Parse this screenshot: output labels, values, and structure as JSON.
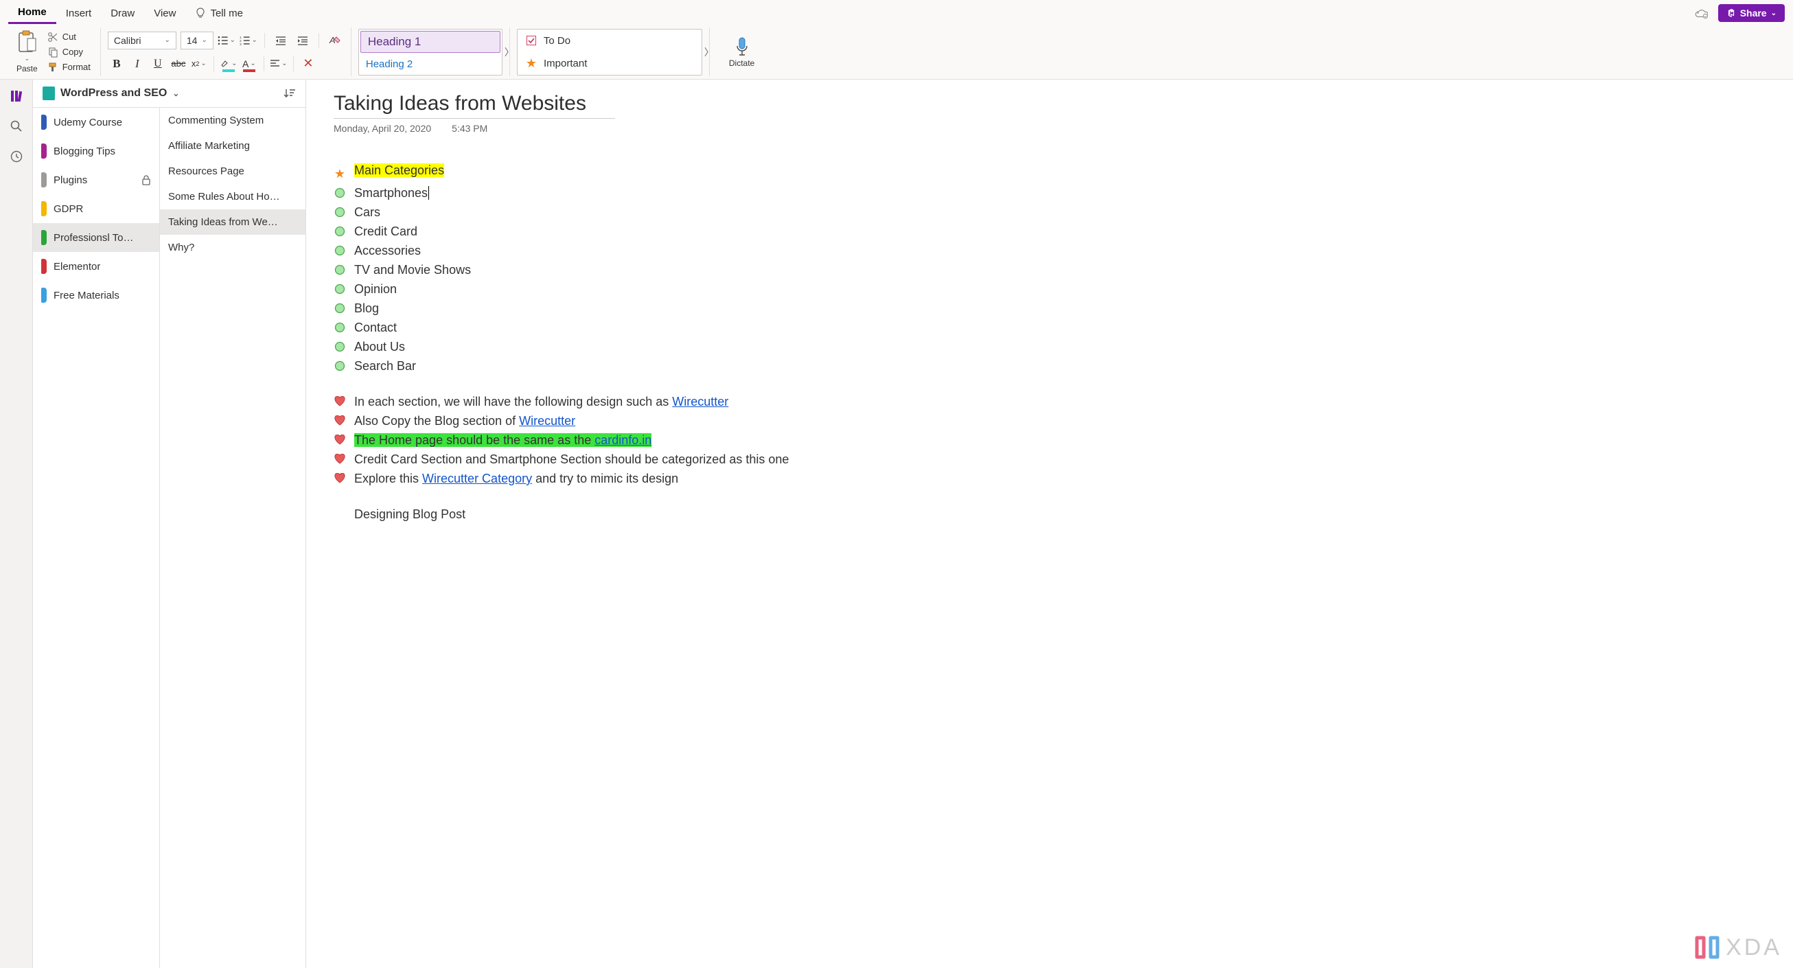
{
  "menubar": {
    "tabs": [
      "Home",
      "Insert",
      "Draw",
      "View"
    ],
    "active": 0,
    "tell_me": "Tell me",
    "share": "Share"
  },
  "ribbon": {
    "paste": "Paste",
    "cut": "Cut",
    "copy": "Copy",
    "format": "Format",
    "font_name": "Calibri",
    "font_size": "14",
    "dictate": "Dictate",
    "styles": {
      "heading1": "Heading 1",
      "heading2": "Heading 2"
    },
    "tags": {
      "todo": "To Do",
      "important": "Important"
    }
  },
  "notebook": {
    "title": "WordPress and SEO",
    "sections": [
      {
        "label": "Udemy Course",
        "color": "#2f5bb7"
      },
      {
        "label": "Blogging Tips",
        "color": "#a4248c"
      },
      {
        "label": "Plugins",
        "color": "#9d9b98",
        "locked": true
      },
      {
        "label": "GDPR",
        "color": "#f2b800"
      },
      {
        "label": "Professionsl To…",
        "color": "#2aa53c",
        "selected": true
      },
      {
        "label": "Elementor",
        "color": "#d13438"
      },
      {
        "label": "Free Materials",
        "color": "#3aa0e0"
      }
    ],
    "pages": [
      {
        "label": "Commenting System"
      },
      {
        "label": "Affiliate Marketing"
      },
      {
        "label": "Resources Page"
      },
      {
        "label": "Some Rules About Ho…"
      },
      {
        "label": "Taking Ideas from We…",
        "selected": true
      },
      {
        "label": "Why?"
      }
    ]
  },
  "note": {
    "title": "Taking Ideas from Websites",
    "date": "Monday, April 20, 2020",
    "time": "5:43 PM",
    "body": {
      "main_categories_label": "Main Categories",
      "circles": [
        "Smartphones",
        "Cars",
        "Credit Card",
        "Accessories",
        "TV and Movie Shows",
        "Opinion",
        "Blog",
        "Contact",
        "About Us",
        "Search Bar"
      ],
      "hearts": [
        {
          "pre": "In each section, we will have the following design such as ",
          "link": "Wirecutter",
          "post": ""
        },
        {
          "pre": "Also Copy the Blog section of ",
          "link": "Wirecutter",
          "post": ""
        },
        {
          "highlight": true,
          "pre": "The Home page should be the same as the ",
          "link": "cardinfo.in",
          "post": " "
        },
        {
          "pre": "Credit Card Section and Smartphone Section should be categorized as this one",
          "wrap": true
        },
        {
          "pre": "Explore this ",
          "link": "Wirecutter Category",
          "post": " and try to mimic its design"
        }
      ],
      "blog_post_heading": "Designing Blog Post"
    }
  },
  "watermark": "XDA"
}
